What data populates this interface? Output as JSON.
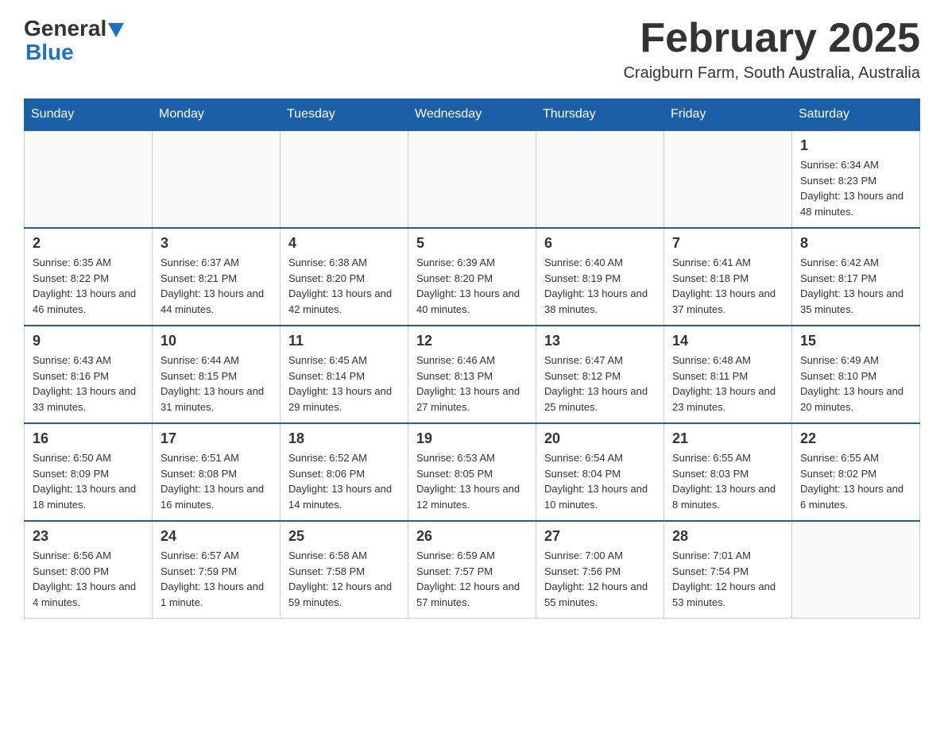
{
  "header": {
    "logo": {
      "general": "General",
      "blue": "Blue"
    },
    "title": "February 2025",
    "location": "Craigburn Farm, South Australia, Australia"
  },
  "calendar": {
    "days_of_week": [
      "Sunday",
      "Monday",
      "Tuesday",
      "Wednesday",
      "Thursday",
      "Friday",
      "Saturday"
    ],
    "weeks": [
      [
        {
          "day": "",
          "info": ""
        },
        {
          "day": "",
          "info": ""
        },
        {
          "day": "",
          "info": ""
        },
        {
          "day": "",
          "info": ""
        },
        {
          "day": "",
          "info": ""
        },
        {
          "day": "",
          "info": ""
        },
        {
          "day": "1",
          "info": "Sunrise: 6:34 AM\nSunset: 8:23 PM\nDaylight: 13 hours and 48 minutes."
        }
      ],
      [
        {
          "day": "2",
          "info": "Sunrise: 6:35 AM\nSunset: 8:22 PM\nDaylight: 13 hours and 46 minutes."
        },
        {
          "day": "3",
          "info": "Sunrise: 6:37 AM\nSunset: 8:21 PM\nDaylight: 13 hours and 44 minutes."
        },
        {
          "day": "4",
          "info": "Sunrise: 6:38 AM\nSunset: 8:20 PM\nDaylight: 13 hours and 42 minutes."
        },
        {
          "day": "5",
          "info": "Sunrise: 6:39 AM\nSunset: 8:20 PM\nDaylight: 13 hours and 40 minutes."
        },
        {
          "day": "6",
          "info": "Sunrise: 6:40 AM\nSunset: 8:19 PM\nDaylight: 13 hours and 38 minutes."
        },
        {
          "day": "7",
          "info": "Sunrise: 6:41 AM\nSunset: 8:18 PM\nDaylight: 13 hours and 37 minutes."
        },
        {
          "day": "8",
          "info": "Sunrise: 6:42 AM\nSunset: 8:17 PM\nDaylight: 13 hours and 35 minutes."
        }
      ],
      [
        {
          "day": "9",
          "info": "Sunrise: 6:43 AM\nSunset: 8:16 PM\nDaylight: 13 hours and 33 minutes."
        },
        {
          "day": "10",
          "info": "Sunrise: 6:44 AM\nSunset: 8:15 PM\nDaylight: 13 hours and 31 minutes."
        },
        {
          "day": "11",
          "info": "Sunrise: 6:45 AM\nSunset: 8:14 PM\nDaylight: 13 hours and 29 minutes."
        },
        {
          "day": "12",
          "info": "Sunrise: 6:46 AM\nSunset: 8:13 PM\nDaylight: 13 hours and 27 minutes."
        },
        {
          "day": "13",
          "info": "Sunrise: 6:47 AM\nSunset: 8:12 PM\nDaylight: 13 hours and 25 minutes."
        },
        {
          "day": "14",
          "info": "Sunrise: 6:48 AM\nSunset: 8:11 PM\nDaylight: 13 hours and 23 minutes."
        },
        {
          "day": "15",
          "info": "Sunrise: 6:49 AM\nSunset: 8:10 PM\nDaylight: 13 hours and 20 minutes."
        }
      ],
      [
        {
          "day": "16",
          "info": "Sunrise: 6:50 AM\nSunset: 8:09 PM\nDaylight: 13 hours and 18 minutes."
        },
        {
          "day": "17",
          "info": "Sunrise: 6:51 AM\nSunset: 8:08 PM\nDaylight: 13 hours and 16 minutes."
        },
        {
          "day": "18",
          "info": "Sunrise: 6:52 AM\nSunset: 8:06 PM\nDaylight: 13 hours and 14 minutes."
        },
        {
          "day": "19",
          "info": "Sunrise: 6:53 AM\nSunset: 8:05 PM\nDaylight: 13 hours and 12 minutes."
        },
        {
          "day": "20",
          "info": "Sunrise: 6:54 AM\nSunset: 8:04 PM\nDaylight: 13 hours and 10 minutes."
        },
        {
          "day": "21",
          "info": "Sunrise: 6:55 AM\nSunset: 8:03 PM\nDaylight: 13 hours and 8 minutes."
        },
        {
          "day": "22",
          "info": "Sunrise: 6:55 AM\nSunset: 8:02 PM\nDaylight: 13 hours and 6 minutes."
        }
      ],
      [
        {
          "day": "23",
          "info": "Sunrise: 6:56 AM\nSunset: 8:00 PM\nDaylight: 13 hours and 4 minutes."
        },
        {
          "day": "24",
          "info": "Sunrise: 6:57 AM\nSunset: 7:59 PM\nDaylight: 13 hours and 1 minute."
        },
        {
          "day": "25",
          "info": "Sunrise: 6:58 AM\nSunset: 7:58 PM\nDaylight: 12 hours and 59 minutes."
        },
        {
          "day": "26",
          "info": "Sunrise: 6:59 AM\nSunset: 7:57 PM\nDaylight: 12 hours and 57 minutes."
        },
        {
          "day": "27",
          "info": "Sunrise: 7:00 AM\nSunset: 7:56 PM\nDaylight: 12 hours and 55 minutes."
        },
        {
          "day": "28",
          "info": "Sunrise: 7:01 AM\nSunset: 7:54 PM\nDaylight: 12 hours and 53 minutes."
        },
        {
          "day": "",
          "info": ""
        }
      ]
    ]
  }
}
